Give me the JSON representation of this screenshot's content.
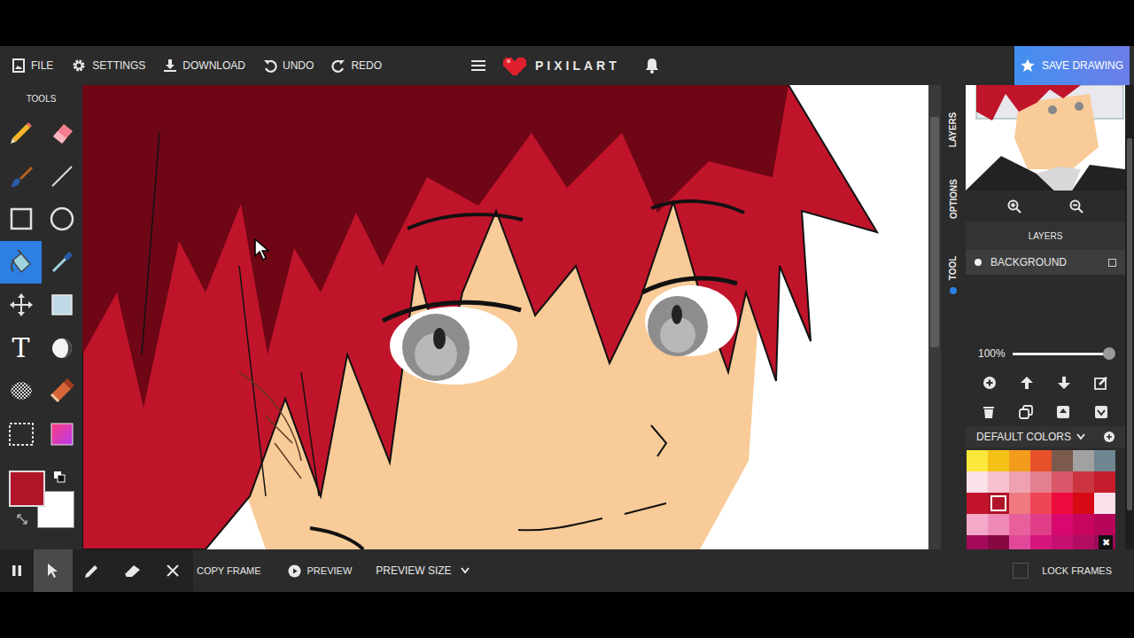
{
  "toolbar": {
    "menu": [
      {
        "label": "FILE"
      },
      {
        "label": "SETTINGS"
      },
      {
        "label": "DOWNLOAD"
      },
      {
        "label": "UNDO"
      },
      {
        "label": "REDO"
      }
    ],
    "logo": "PIXILART",
    "save_button": "SAVE DRAWING"
  },
  "tools": {
    "title": "TOOLS",
    "text_tool_glyph": "T",
    "items": [
      {
        "selected": false
      },
      {
        "selected": false
      },
      {
        "selected": false
      },
      {
        "selected": false
      },
      {
        "selected": false
      },
      {
        "selected": false
      },
      {
        "selected": true
      },
      {
        "selected": false
      },
      {
        "selected": false
      },
      {
        "selected": false
      },
      {
        "selected": false
      },
      {
        "selected": false
      },
      {
        "selected": false
      },
      {
        "selected": false
      },
      {
        "selected": false
      },
      {
        "selected": false
      }
    ],
    "primary_color": "#b01429",
    "secondary_color": "#ffffff"
  },
  "side_tabs": [
    {
      "label": "LAYERS",
      "selected": false
    },
    {
      "label": "OPTIONS",
      "selected": false
    },
    {
      "label": "TOOL",
      "selected": true
    }
  ],
  "layers": {
    "title": "LAYERS",
    "items": [
      {
        "name": "BACKGROUND",
        "visible": true,
        "checked": false
      }
    ],
    "opacity": {
      "reading": "100%",
      "level": 1
    }
  },
  "palette": {
    "title": "DEFAULT COLORS",
    "close": "✖",
    "colors": [
      {
        "color": "#fbe83a",
        "selected": false
      },
      {
        "color": "#f5c117",
        "selected": false
      },
      {
        "color": "#f39b1b",
        "selected": false
      },
      {
        "color": "#e7502b",
        "selected": false
      },
      {
        "color": "#7b5a4d",
        "selected": false
      },
      {
        "color": "#a1a1a1",
        "selected": false
      },
      {
        "color": "#6f8591",
        "selected": false
      },
      {
        "color": "#fbe1e8",
        "selected": false
      },
      {
        "color": "#f8c2cf",
        "selected": false
      },
      {
        "color": "#eea1b0",
        "selected": false
      },
      {
        "color": "#e2808f",
        "selected": false
      },
      {
        "color": "#d85869",
        "selected": false
      },
      {
        "color": "#cc3440",
        "selected": false
      },
      {
        "color": "#c41c2c",
        "selected": false
      },
      {
        "color": "#c1142c",
        "selected": false
      },
      {
        "color": "#b01429",
        "selected": true
      },
      {
        "color": "#f07a80",
        "selected": false
      },
      {
        "color": "#f04555",
        "selected": false
      },
      {
        "color": "#ee0c3f",
        "selected": false
      },
      {
        "color": "#d60a14",
        "selected": false
      },
      {
        "color": "#fbe0ea",
        "selected": false
      },
      {
        "color": "#f4a9c8",
        "selected": false
      },
      {
        "color": "#ef8ab6",
        "selected": false
      },
      {
        "color": "#e7609c",
        "selected": false
      },
      {
        "color": "#e03e87",
        "selected": false
      },
      {
        "color": "#d8086e",
        "selected": false
      },
      {
        "color": "#c80660",
        "selected": false
      },
      {
        "color": "#b7055a",
        "selected": false
      },
      {
        "color": "#a40a5a",
        "selected": false
      },
      {
        "color": "#870842",
        "selected": false
      },
      {
        "color": "#e2489a",
        "selected": false
      },
      {
        "color": "#d6157d",
        "selected": false
      },
      {
        "color": "#c70f6f",
        "selected": false
      },
      {
        "color": "#b20c63",
        "selected": false
      },
      {
        "color": "#9a0a55",
        "selected": false
      }
    ]
  },
  "frames_bar": {
    "tools": [
      {
        "selected": false
      },
      {
        "selected": true
      },
      {
        "selected": false
      },
      {
        "selected": false
      },
      {
        "selected": false
      }
    ],
    "copy_frame": "COPY FRAME",
    "preview": "PREVIEW",
    "preview_size": "PREVIEW SIZE",
    "lock_frames": {
      "label": "LOCK FRAMES",
      "checked": false
    }
  }
}
